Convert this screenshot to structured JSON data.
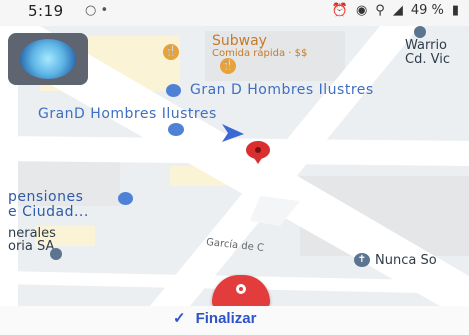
{
  "status_bar": {
    "time": "5:19",
    "battery": "49 %"
  },
  "map": {
    "pois": {
      "subway_name": "Subway",
      "subway_sub": "Comida rápida · $$",
      "warrior_line1": "Warrio",
      "warrior_line2": "Cd. Vic",
      "grand_hombres_1": "Gran D Hombres Ilustres",
      "grand_hombres_2": "GranD Hombres Ilustres",
      "pensiones_line1": "pensiones",
      "pensiones_line2": "e Ciudad...",
      "generales_line1": "nerales",
      "generales_line2": "oria SA",
      "nunca": "Nunca So",
      "street": "García de C"
    }
  },
  "actions": {
    "finish_label": "Finalizar"
  },
  "icons": [
    "wifi-icon",
    "signal-icon",
    "battery-icon",
    "fork-knife-icon",
    "bus-icon",
    "location-pin-icon",
    "navigation-arrow-icon",
    "locate-me-icon",
    "checkmark-icon",
    "cross-icon"
  ],
  "colors": {
    "accent_blue": "#2d55c8",
    "marker_red": "#e23c3c",
    "poi_blue": "#3f6fc0",
    "poi_orange": "#c67a2a"
  }
}
